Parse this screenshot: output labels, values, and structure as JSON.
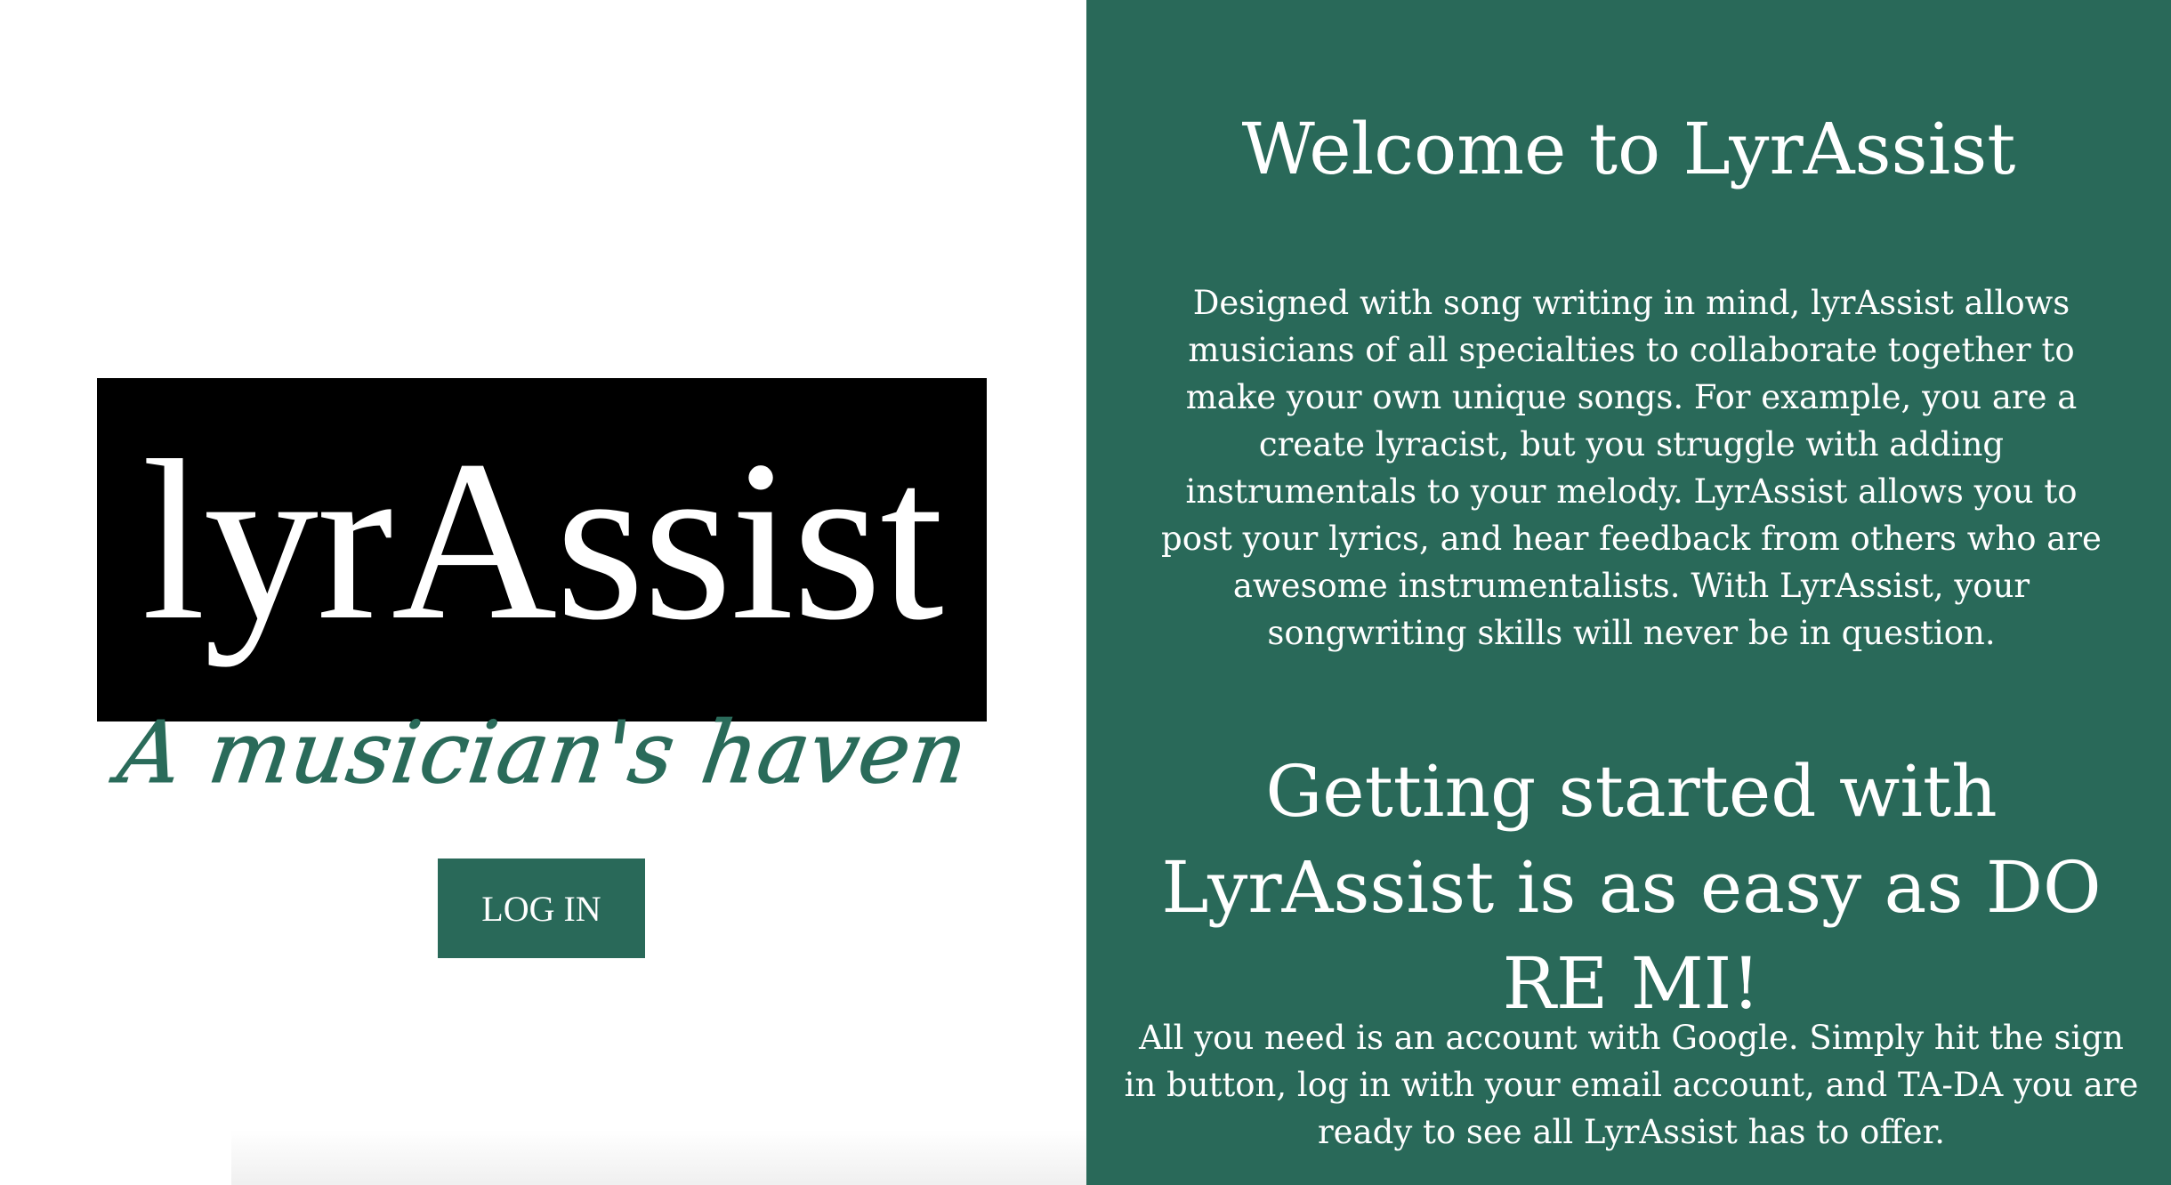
{
  "left_panel": {
    "logo_text": "lyrAssist",
    "tagline": "A musician's haven",
    "login_label": "LOG IN"
  },
  "right_panel": {
    "welcome_title": "Welcome to LyrAssist",
    "intro_paragraph": "Designed with song writing in mind, lyrAssist allows musicians of all specialties to collaborate together to make your own unique songs. For example, you are a create lyracist, but you struggle with adding instrumentals to your melody. LyrAssist allows you to post your lyrics, and hear feedback from others who are awesome instrumentalists. With LyrAssist, your songwriting skills will never be in question.",
    "getting_started_title": "Getting started with LyrAssist is as easy as DO RE MI!",
    "steps_paragraph": "All you need is an account with Google. Simply hit the sign in button, log in with your email account, and TA-DA you are ready to see all LyrAssist has to offer."
  },
  "colors": {
    "brand_green": "#296959",
    "logo_background": "#000000",
    "text_on_green": "#ffffff"
  }
}
